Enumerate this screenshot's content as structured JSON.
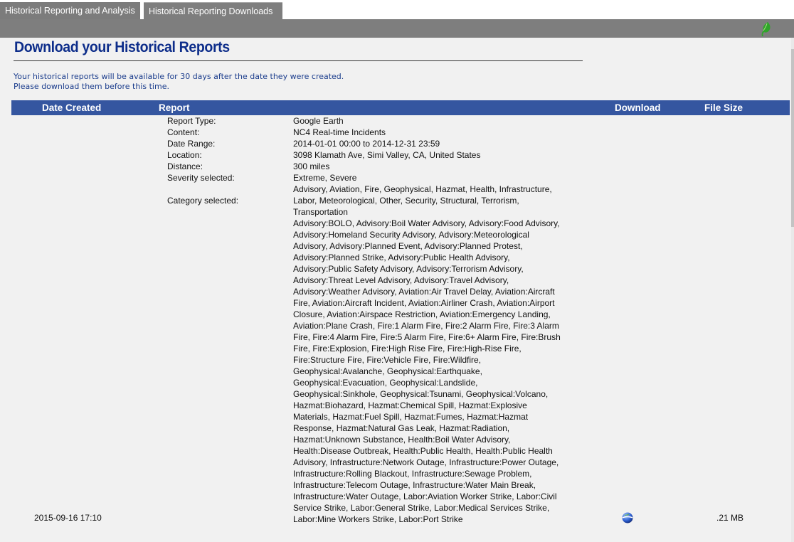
{
  "tabs": [
    {
      "label": "Historical Reporting and Analysis"
    },
    {
      "label": "Historical Reporting Downloads"
    }
  ],
  "page": {
    "title": "Download your Historical Reports",
    "notice_line1": "Your historical reports will be available for 30 days after the date they were created.",
    "notice_line2": "Please download them before this time."
  },
  "table": {
    "headers": {
      "date_created": "Date Created",
      "report": "Report",
      "download": "Download",
      "file_size": "File Size"
    },
    "rows": [
      {
        "date_created": "2015-09-16 17:10",
        "file_size": ".21 MB",
        "download_icon": "google-earth-globe-icon",
        "details": {
          "report_type_label": "Report Type:",
          "report_type": "Google Earth",
          "content_label": "Content:",
          "content": "NC4 Real-time Incidents",
          "date_range_label": "Date Range:",
          "date_range": "2014-01-01 00:00 to 2014-12-31 23:59",
          "location_label": "Location:",
          "location": "3098 Klamath Ave, Simi Valley, CA, United States",
          "distance_label": "Distance:",
          "distance": "300 miles",
          "severity_label": "Severity selected:",
          "severity": "Extreme, Severe",
          "category_label": "Category selected:",
          "category": "Advisory, Aviation, Fire, Geophysical, Hazmat, Health, Infrastructure, Labor, Meteorological, Other, Security, Structural, Terrorism, Transportation",
          "subcategory": "Advisory:BOLO, Advisory:Boil Water Advisory, Advisory:Food Advisory, Advisory:Homeland Security Advisory, Advisory:Meteorological Advisory, Advisory:Planned Event, Advisory:Planned Protest, Advisory:Planned Strike, Advisory:Public Health Advisory, Advisory:Public Safety Advisory, Advisory:Terrorism Advisory, Advisory:Threat Level Advisory, Advisory:Travel Advisory, Advisory:Weather Advisory, Aviation:Air Travel Delay, Aviation:Aircraft Fire, Aviation:Aircraft Incident, Aviation:Airliner Crash, Aviation:Airport Closure, Aviation:Airspace Restriction, Aviation:Emergency Landing, Aviation:Plane Crash, Fire:1 Alarm Fire, Fire:2 Alarm Fire, Fire:3 Alarm Fire, Fire:4 Alarm Fire, Fire:5 Alarm Fire, Fire:6+ Alarm Fire, Fire:Brush Fire, Fire:Explosion, Fire:High Rise Fire, Fire:High-Rise Fire, Fire:Structure Fire, Fire:Vehicle Fire, Fire:Wildfire, Geophysical:Avalanche, Geophysical:Earthquake, Geophysical:Evacuation, Geophysical:Landslide, Geophysical:Sinkhole, Geophysical:Tsunami, Geophysical:Volcano, Hazmat:Biohazard, Hazmat:Chemical Spill, Hazmat:Explosive Materials, Hazmat:Fuel Spill, Hazmat:Fumes, Hazmat:Hazmat Response, Hazmat:Natural Gas Leak, Hazmat:Radiation, Hazmat:Unknown Substance, Health:Boil Water Advisory, Health:Disease Outbreak, Health:Public Health, Health:Public Health Advisory, Infrastructure:Network Outage, Infrastructure:Power Outage, Infrastructure:Rolling Blackout, Infrastructure:Sewage Problem, Infrastructure:Telecom Outage, Infrastructure:Water Main Break, Infrastructure:Water Outage, Labor:Aviation Worker Strike, Labor:Civil Service Strike, Labor:General Strike, Labor:Medical Services Strike, Labor:Mine Workers Strike, Labor:Port Strike"
        }
      }
    ]
  },
  "icons": {
    "header_icon": "green-leaf-icon"
  },
  "colors": {
    "title": "#0d2d8a",
    "header_bg": "#3556a0",
    "tab_bg": "#7c7c7c",
    "content_bg": "#f1f1f1"
  }
}
